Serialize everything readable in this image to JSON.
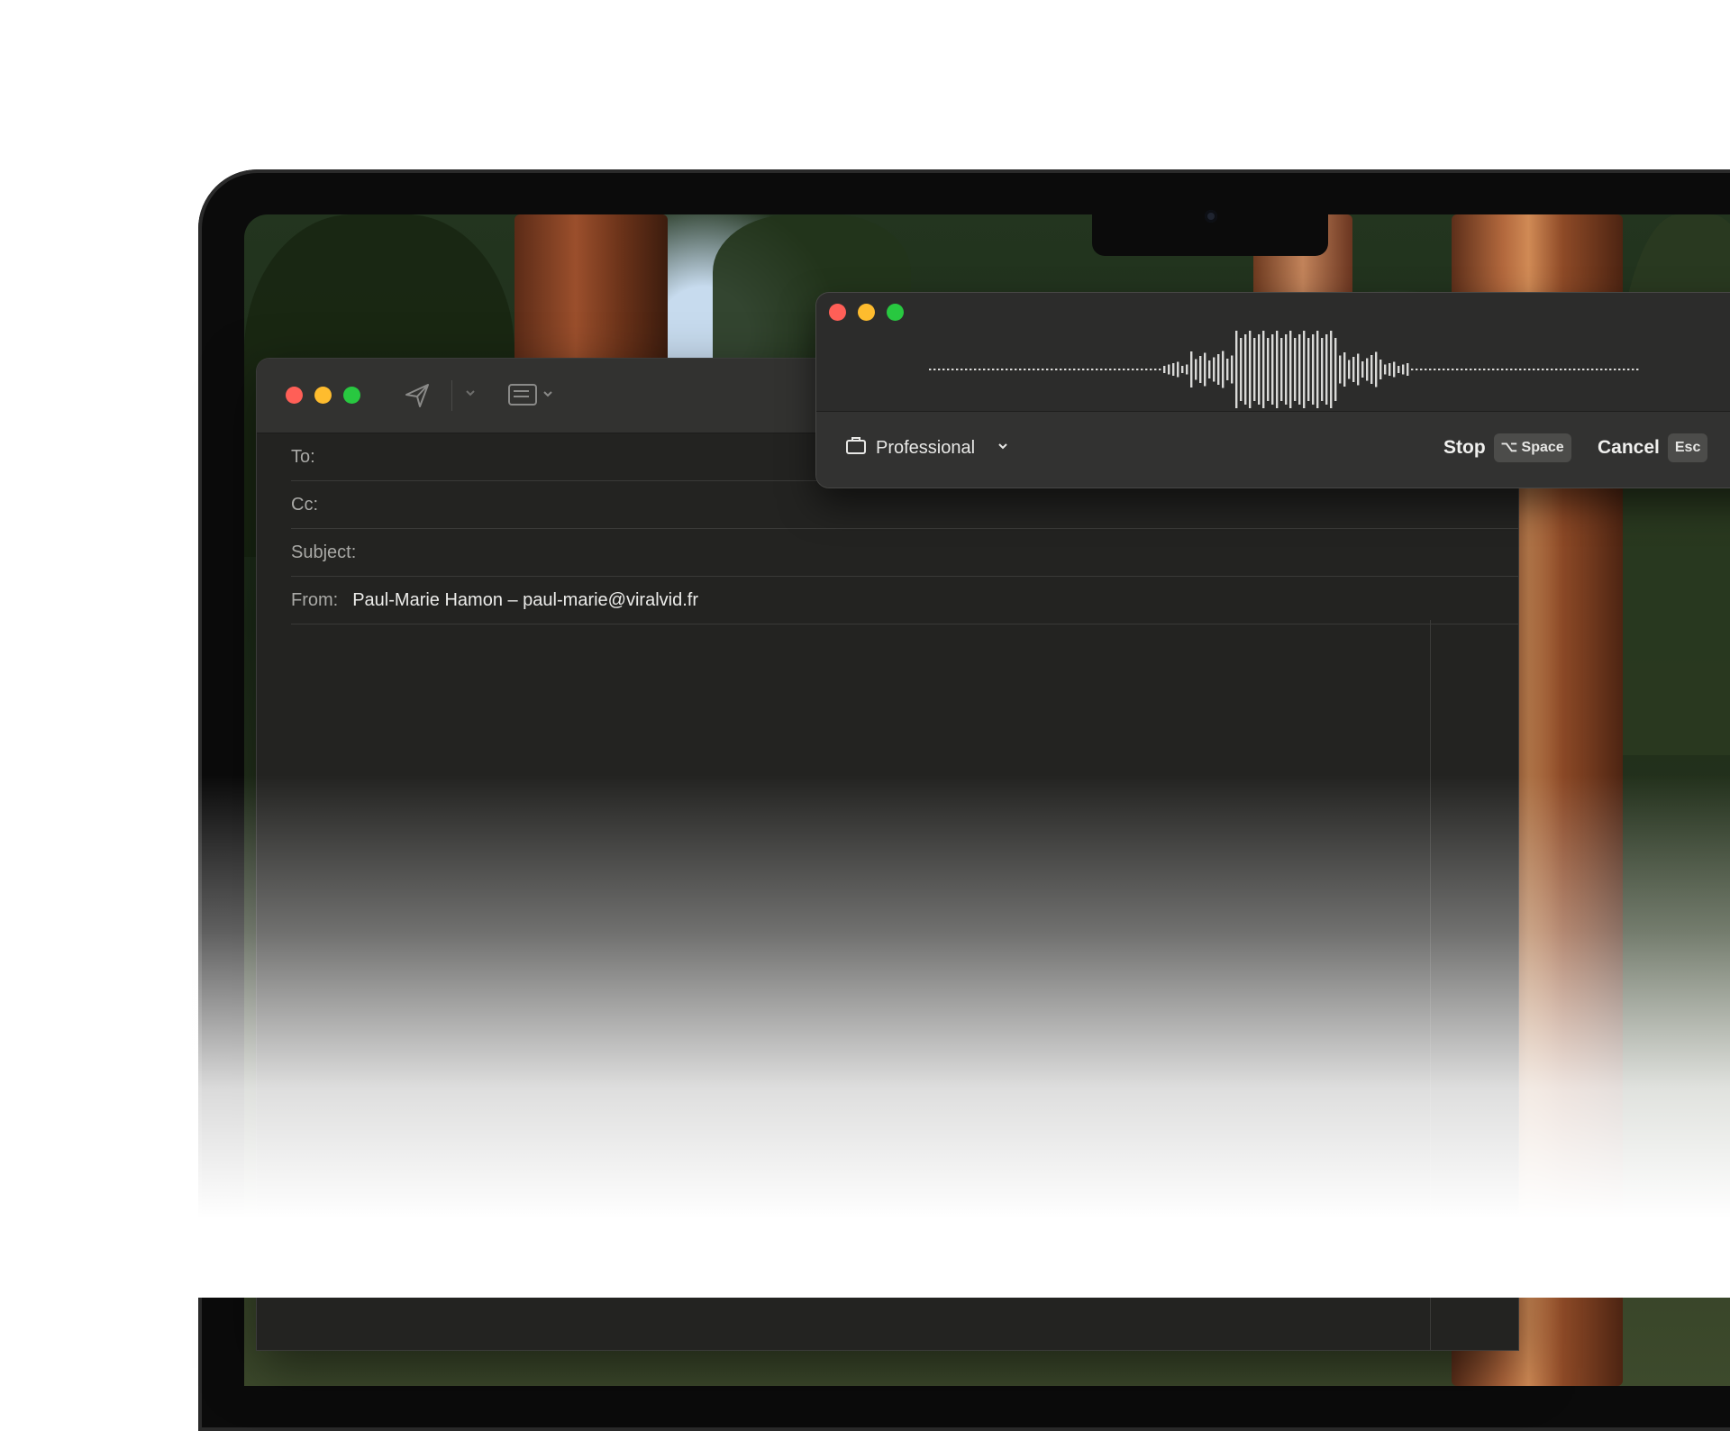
{
  "mail": {
    "to_label": "To:",
    "cc_label": "Cc:",
    "subject_label": "Subject:",
    "from_label": "From:",
    "from_value": "Paul-Marie Hamon – paul-marie@viralvid.fr"
  },
  "dictation": {
    "style_label": "Professional",
    "stop_label": "Stop",
    "stop_shortcut": "⌥ Space",
    "cancel_label": "Cancel",
    "cancel_shortcut": "Esc",
    "icons": {
      "style": "briefcase-icon",
      "dropdown": "chevron-down-icon"
    }
  },
  "colors": {
    "close": "#ff5f57",
    "minimize": "#febc2e",
    "zoom": "#28c840"
  }
}
